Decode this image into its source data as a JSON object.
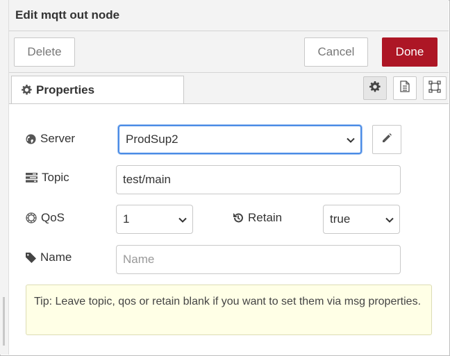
{
  "dialog": {
    "title": "Edit mqtt out node"
  },
  "buttons": {
    "delete_label": "Delete",
    "cancel_label": "Cancel",
    "done_label": "Done",
    "done_color": "#ad1625"
  },
  "tabs": [
    {
      "label": "Properties",
      "icon": "gear-icon",
      "active": true
    }
  ],
  "tab_tools": [
    {
      "icon": "gear-icon",
      "active": true
    },
    {
      "icon": "document-icon",
      "active": false
    },
    {
      "icon": "frame-icon",
      "active": false
    }
  ],
  "form": {
    "server": {
      "label": "Server",
      "icon": "globe-icon",
      "value": "ProdSup2",
      "edit_icon": "pencil-icon"
    },
    "topic": {
      "label": "Topic",
      "icon": "tasks-icon",
      "value": "test/main"
    },
    "qos": {
      "label": "QoS",
      "icon": "empire-icon",
      "value": "1"
    },
    "retain": {
      "label": "Retain",
      "icon": "history-icon",
      "value": "true"
    },
    "name": {
      "label": "Name",
      "icon": "tag-icon",
      "value": "",
      "placeholder": "Name"
    }
  },
  "tip": {
    "text": "Tip: Leave topic, qos or retain blank if you want to set them via msg properties."
  }
}
